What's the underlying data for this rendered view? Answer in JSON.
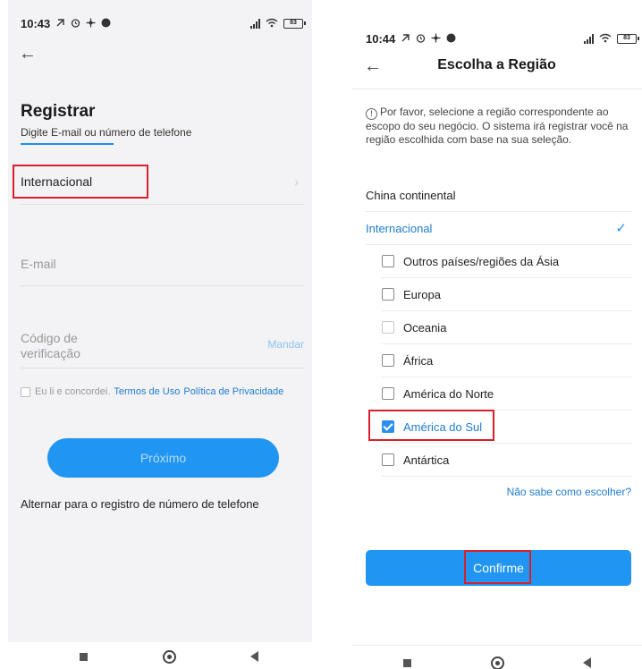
{
  "left": {
    "status_time": "10:43",
    "status_icons": [
      "notification-icon",
      "alarm-icon",
      "app-icon",
      "app-icon"
    ],
    "battery": "83",
    "title": "Registrar",
    "subtitle": "Digite E-mail ou número de telefone",
    "region_value": "Internacional",
    "email_placeholder": "E-mail",
    "code_placeholder": "Código de verificação",
    "send_label": "Mandar",
    "agree_text": "Eu li e concordei.",
    "terms_link": "Termos de Uso",
    "privacy_link": "Política de Privacidade",
    "next_label": "Próximo",
    "switch_label": "Alternar para o registro de número de telefone"
  },
  "right": {
    "status_time": "10:44",
    "battery": "83",
    "title": "Escolha a Região",
    "notice": "Por favor, selecione a região correspondente ao escopo do seu negócio. O sistema irá registrar você na região escolhida com base na sua seleção.",
    "top_regions": [
      {
        "label": "China continental",
        "selected": false
      },
      {
        "label": "Internacional",
        "selected": true
      }
    ],
    "sub_regions": [
      {
        "label": "Outros países/regiões da Ásia",
        "checked": false
      },
      {
        "label": "Europa",
        "checked": false
      },
      {
        "label": "Oceania",
        "checked": false
      },
      {
        "label": "África",
        "checked": false
      },
      {
        "label": "América do Norte",
        "checked": false
      },
      {
        "label": "América do Sul",
        "checked": true
      },
      {
        "label": "Antártica",
        "checked": false
      }
    ],
    "help_link": "Não sabe como escolher?",
    "confirm_label": "Confirme"
  },
  "colors": {
    "accent": "#2195f2",
    "link": "#1f7ccf",
    "highlight": "#d8202a"
  }
}
